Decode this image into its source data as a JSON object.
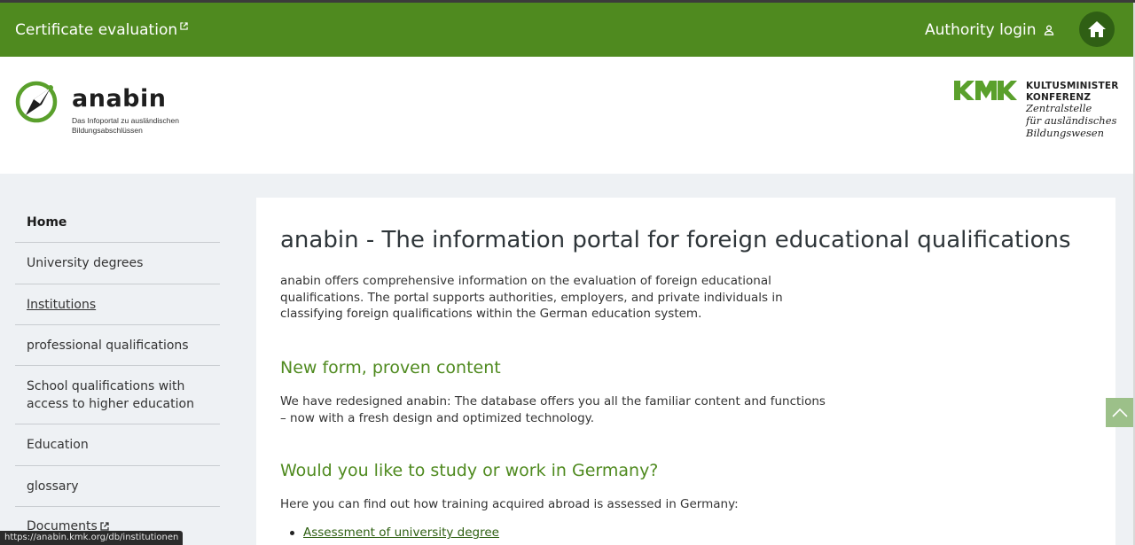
{
  "topbar": {
    "certificate_label": "Certificate evaluation",
    "authority_label": "Authority login",
    "bg_color": "#4f8a1f"
  },
  "header": {
    "logo_name": "anabin",
    "logo_tagline": "Das Infoportal zu ausländischen Bildungsabschlüssen",
    "kmk_line1": "KULTUSMINISTER",
    "kmk_line2": "KONFERENZ",
    "kmk_line3": "Zentralstelle",
    "kmk_line4": "für ausländisches",
    "kmk_line5": "Bildungswesen"
  },
  "sidebar": {
    "items": [
      {
        "label": "Home"
      },
      {
        "label": "University degrees"
      },
      {
        "label": "Institutions"
      },
      {
        "label": "professional qualifications"
      },
      {
        "label": "School qualifications with access to higher education"
      },
      {
        "label": "Education"
      },
      {
        "label": "glossary"
      },
      {
        "label": "Documents"
      }
    ]
  },
  "main": {
    "title": "anabin - The information portal for foreign educational qualifications",
    "intro": "anabin offers comprehensive information on the evaluation of foreign educational qualifications. The portal supports authorities, employers, and private individuals in classifying foreign qualifications within the German education system.",
    "section1_title": "New form, proven content",
    "section1_text": "We have redesigned anabin: The database offers you all the familiar content and functions – now with a fresh design and optimized technology.",
    "section2_title": "Would you like to study or work in Germany?",
    "section2_text": "Here you can find out how training acquired abroad is assessed in Germany:",
    "link1": "Assessment of university degree"
  },
  "status_bar": {
    "url": "https://anabin.kmk.org/db/institutionen"
  },
  "colors": {
    "accent_green": "#4f8a1f",
    "heading_green": "#4f8a1f",
    "dark_green": "#2f5f14"
  }
}
